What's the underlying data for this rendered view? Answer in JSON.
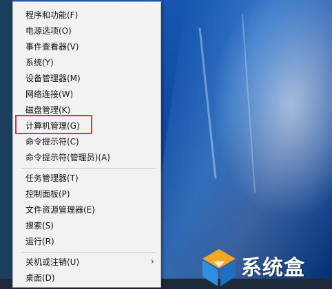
{
  "menu": {
    "items": [
      {
        "label": "程序和功能(F)"
      },
      {
        "label": "电源选项(O)"
      },
      {
        "label": "事件查看器(V)"
      },
      {
        "label": "系统(Y)"
      },
      {
        "label": "设备管理器(M)"
      },
      {
        "label": "网络连接(W)"
      },
      {
        "label": "磁盘管理(K)"
      },
      {
        "label": "计算机管理(G)"
      },
      {
        "label": "命令提示符(C)"
      },
      {
        "label": "命令提示符(管理员)(A)"
      },
      {
        "label": "任务管理器(T)"
      },
      {
        "label": "控制面板(P)"
      },
      {
        "label": "文件资源管理器(E)"
      },
      {
        "label": "搜索(S)"
      },
      {
        "label": "运行(R)"
      },
      {
        "label": "关机或注销(U)"
      },
      {
        "label": "桌面(D)"
      }
    ]
  },
  "watermark": {
    "text": "系统盒"
  },
  "colors": {
    "highlight_border": "#e03232",
    "menu_background": "#f2f2f2",
    "logo_orange": "#f5a623",
    "logo_blue": "#2f8fe0"
  }
}
